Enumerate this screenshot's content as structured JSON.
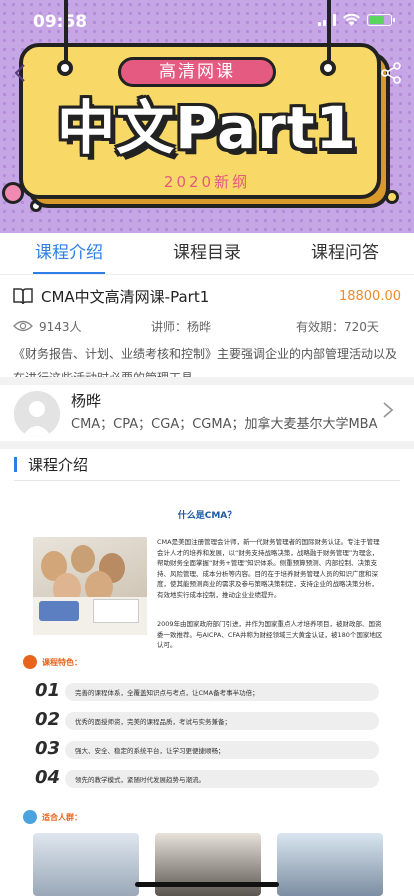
{
  "status_bar": {
    "time": "09:58"
  },
  "hero": {
    "tag": "高清网课",
    "title": "中文Part1",
    "subtitle": "2020新纲",
    "colors": {
      "bg": "#c7a6e6",
      "board": "#f8d866",
      "tag": "#e55a80"
    }
  },
  "tabs": [
    {
      "label": "课程介绍",
      "active": true
    },
    {
      "label": "课程目录",
      "active": false
    },
    {
      "label": "课程问答",
      "active": false
    }
  ],
  "course": {
    "title": "CMA中文高清网课-Part1",
    "price": "18800.00",
    "views": "9143人",
    "teacher": "讲师：杨晔",
    "validity": "有效期：720天",
    "description": "《财务报告、计划、业绩考核和控制》主要强调企业的内部管理活动以及在进行这些活动时必要的管理工具。"
  },
  "lecturer": {
    "name": "杨晔",
    "tags": "CMA；CPA；CGA；CGMA；加拿大麦基尔大学MBA"
  },
  "section": {
    "title": "课程介绍"
  },
  "promo": {
    "question": "什么是CMA？",
    "intro_1": "CMA是美国注册管理会计师，新一代财务管理者的国际财务认证。专注于管理会计人才的培养和发展，以“财务支持战略决策，战略融于财务管理”为理念，帮助财务全面掌握“财务+管理”知识体系。侧重预算预测、内部控制、决策支持、风险管理、成本分析等内容。目的在于培养财务管理人员的知识广度和深度，使其能预测商业的需求及参与策略决策制定，支持企业的战略决策分析，有效地实行成本控制，推动企业业绩提升。",
    "intro_2": "2009年由国家政府部门引进，并作为国家重点人才培养项目，被财政部、国资委一致推荐。与AICPA、CFA并称为财经领域三大黄金认证，被180个国家地区认可。",
    "features_title": "课程特色：",
    "features": [
      {
        "num": "01",
        "text": "完善的课程体系，全覆盖知识点与考点，让CMA备考事半功倍；"
      },
      {
        "num": "02",
        "text": "优秀的面授师资，完美的课程品质，考试与实务兼备；"
      },
      {
        "num": "03",
        "text": "强大、安全、稳定的系统平台，让学习更便捷顺畅；"
      },
      {
        "num": "04",
        "text": "领先的教学模式，紧随时代发展趋势与潮流。"
      }
    ],
    "audience_title": "适合人群："
  }
}
